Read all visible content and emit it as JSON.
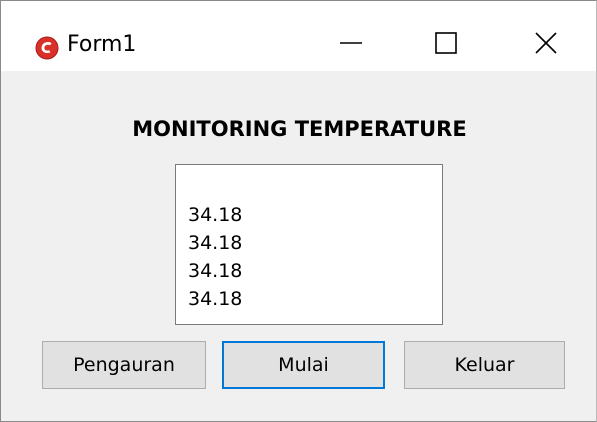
{
  "window": {
    "title": "Form1",
    "icon": "app-icon-red"
  },
  "caption_buttons": {
    "minimize_icon": "minimize-icon",
    "maximize_icon": "maximize-icon",
    "close_icon": "close-icon"
  },
  "main": {
    "heading": "MONITORING TEMPERATURE",
    "listbox_items": [
      "34.18",
      "34.18",
      "34.18",
      "34.18"
    ]
  },
  "buttons": {
    "pengaturan_label": "Pengauran",
    "mulai_label": "Mulai",
    "keluar_label": "Keluar"
  },
  "colors": {
    "form_background": "#f0f0f0",
    "titlebar_background": "#ffffff",
    "button_background": "#e1e1e1",
    "focus_border": "#0078d7",
    "icon_red": "#d9302a"
  }
}
